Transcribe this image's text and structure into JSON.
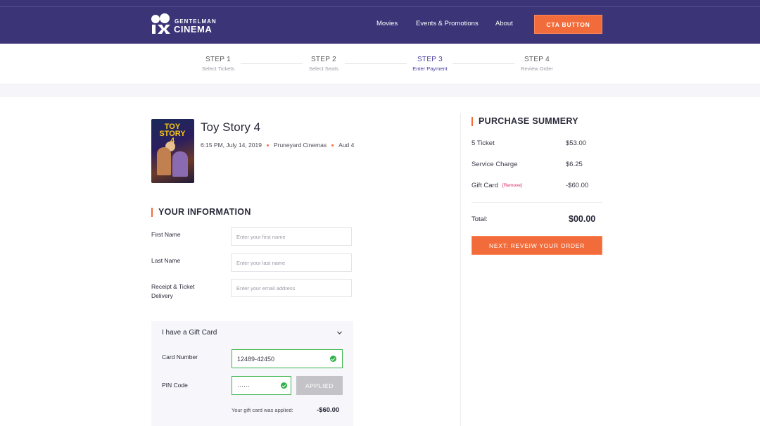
{
  "header": {
    "logo_line1": "GENTELMAN",
    "logo_line2": "CINEMA",
    "nav": [
      "Movies",
      "Events & Promotions",
      "About"
    ],
    "cta_label": "CTA BUTTON",
    "colors": {
      "bar": "#3b3577",
      "accent": "#f26b3a"
    }
  },
  "steps": [
    {
      "label": "STEP 1",
      "sub": "Select Tickets",
      "active": false
    },
    {
      "label": "STEP 2",
      "sub": "Select Seats",
      "active": false
    },
    {
      "label": "STEP 3",
      "sub": "Enter Payment",
      "active": true
    },
    {
      "label": "STEP 4",
      "sub": "Review Order",
      "active": false
    }
  ],
  "movie": {
    "poster_text": "TOY STORY 4",
    "title": "Toy Story 4",
    "datetime": "6:15 PM, July 14, 2019",
    "theater": "Pruneyard Cinemas",
    "auditorium": "Aud 4"
  },
  "info": {
    "heading": "YOUR INFORMATION",
    "fields": [
      {
        "label": "First Name",
        "placeholder": "Enter your first name"
      },
      {
        "label": "Last Name",
        "placeholder": "Enter your last name"
      },
      {
        "label": "Receipt & Ticket Delivery",
        "placeholder": "Enter your email address"
      }
    ]
  },
  "gift_card": {
    "title": "I have a Gift Card",
    "card_label": "Card Number",
    "card_value": "12489-42450",
    "pin_label": "PIN Code",
    "pin_value": "······",
    "applied_label": "APPLIED",
    "note": "Your gift card was applied:",
    "amount": "-$60.00"
  },
  "summary": {
    "heading": "PURCHASE SUMMERY",
    "rows": [
      {
        "label": "5 Ticket",
        "value": "$53.00"
      },
      {
        "label": "Service Charge",
        "value": "$6.25"
      },
      {
        "label": "Gift Card",
        "remove": "[Remove]",
        "value": "-$60.00"
      }
    ],
    "total_label": "Total:",
    "total_value": "$00.00",
    "next_label": "NEXT: REVEIW YOUR ORDER"
  }
}
